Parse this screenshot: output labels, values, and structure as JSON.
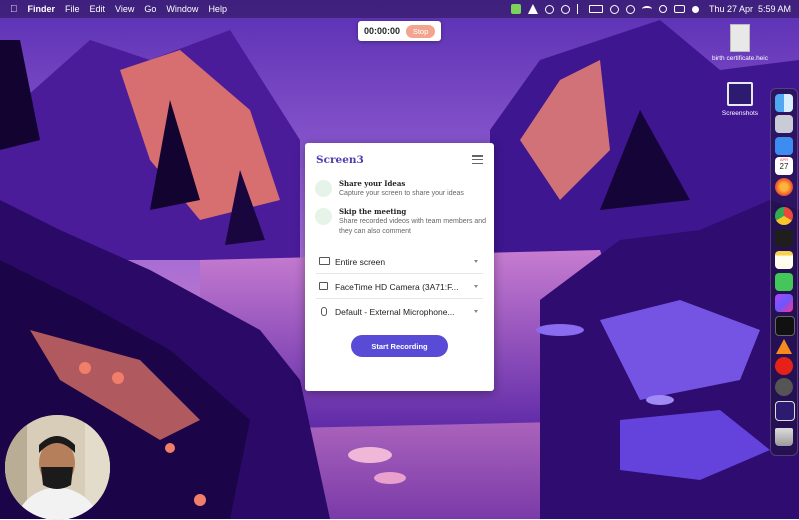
{
  "menubar": {
    "apple": "",
    "app": "Finder",
    "items": [
      "File",
      "Edit",
      "View",
      "Go",
      "Window",
      "Help"
    ],
    "datetime": "Thu 27 Apr  5:59 AM"
  },
  "recorder": {
    "time": "00:00:00",
    "stop_label": "Stop"
  },
  "desktop_icons": [
    {
      "label": "birth certificate.heic"
    },
    {
      "label": "Screenshots"
    }
  ],
  "panel": {
    "brand": "Screen3",
    "features": [
      {
        "title": "Share your Ideas",
        "desc": "Capture your screen to share your ideas"
      },
      {
        "title": "Skip the meeting",
        "desc": "Share recorded videos with team members and they can also comment"
      }
    ],
    "sources": {
      "screen": "Entire screen",
      "camera": "FaceTime HD Camera (3A71:F...",
      "microphone": "Default - External Microphone..."
    },
    "start_label": "Start Recording"
  },
  "dock": {
    "calendar_month": "APR",
    "calendar_day": "27",
    "apps": [
      "finder",
      "launchpad",
      "mail",
      "calendar",
      "firefox",
      "chrome",
      "figma",
      "notes",
      "messages",
      "phpstorm",
      "terminal",
      "vlc",
      "youtube-music",
      "compass",
      "screenshots",
      "trash"
    ]
  }
}
